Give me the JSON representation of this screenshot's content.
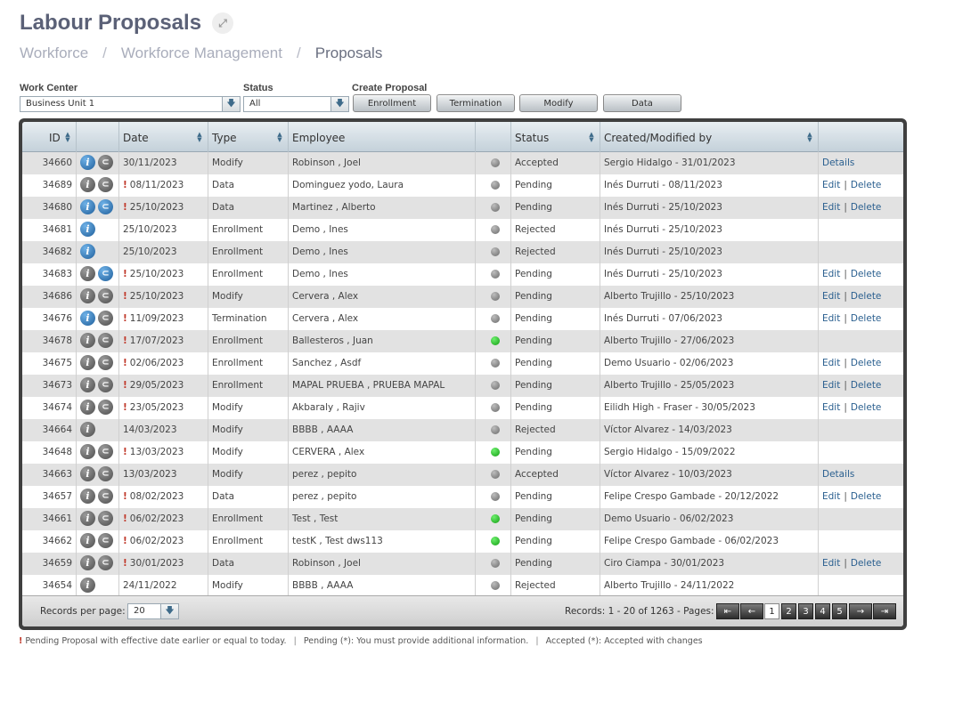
{
  "page": {
    "title": "Labour Proposals"
  },
  "breadcrumb": [
    "Workforce",
    "Workforce Management",
    "Proposals"
  ],
  "filters": {
    "work_center_label": "Work Center",
    "work_center_value": "Business Unit 1",
    "status_label": "Status",
    "status_value": "All",
    "create_label": "Create Proposal",
    "create_buttons": [
      "Enrollment",
      "Termination",
      "Modify",
      "Data"
    ]
  },
  "table": {
    "columns": [
      "ID",
      "Date",
      "Type",
      "Employee",
      "Status",
      "Created/Modified by"
    ],
    "rows": [
      {
        "id": "34660",
        "info": "blue",
        "clip": "grey",
        "warn": false,
        "date": "30/11/2023",
        "type": "Modify",
        "employee": "Robinson , Joel",
        "dot": "grey",
        "status": "Accepted",
        "by": "Sergio Hidalgo - 31/01/2023",
        "actions": [
          "Details"
        ]
      },
      {
        "id": "34689",
        "info": "grey",
        "clip": "grey",
        "warn": true,
        "date": "08/11/2023",
        "type": "Data",
        "employee": "Dominguez yodo, Laura",
        "dot": "grey",
        "status": "Pending",
        "by": "Inés Durruti - 08/11/2023",
        "actions": [
          "Edit",
          "Delete"
        ]
      },
      {
        "id": "34680",
        "info": "blue",
        "clip": "blue",
        "warn": true,
        "date": "25/10/2023",
        "type": "Data",
        "employee": "Martinez , Alberto",
        "dot": "grey",
        "status": "Pending",
        "by": "Inés Durruti - 25/10/2023",
        "actions": [
          "Edit",
          "Delete"
        ]
      },
      {
        "id": "34681",
        "info": "blue",
        "clip": "",
        "warn": false,
        "date": "25/10/2023",
        "type": "Enrollment",
        "employee": "Demo , Ines",
        "dot": "grey",
        "status": "Rejected",
        "by": "Inés Durruti - 25/10/2023",
        "actions": []
      },
      {
        "id": "34682",
        "info": "blue",
        "clip": "",
        "warn": false,
        "date": "25/10/2023",
        "type": "Enrollment",
        "employee": "Demo , Ines",
        "dot": "grey",
        "status": "Rejected",
        "by": "Inés Durruti - 25/10/2023",
        "actions": []
      },
      {
        "id": "34683",
        "info": "grey",
        "clip": "blue",
        "warn": true,
        "date": "25/10/2023",
        "type": "Enrollment",
        "employee": "Demo , Ines",
        "dot": "grey",
        "status": "Pending",
        "by": "Inés Durruti - 25/10/2023",
        "actions": [
          "Edit",
          "Delete"
        ]
      },
      {
        "id": "34686",
        "info": "grey",
        "clip": "grey",
        "warn": true,
        "date": "25/10/2023",
        "type": "Modify",
        "employee": "Cervera , Alex",
        "dot": "grey",
        "status": "Pending",
        "by": "Alberto Trujillo - 25/10/2023",
        "actions": [
          "Edit",
          "Delete"
        ]
      },
      {
        "id": "34676",
        "info": "blue",
        "clip": "grey",
        "warn": true,
        "date": "11/09/2023",
        "type": "Termination",
        "employee": "Cervera , Alex",
        "dot": "grey",
        "status": "Pending",
        "by": "Inés Durruti - 07/06/2023",
        "actions": [
          "Edit",
          "Delete"
        ]
      },
      {
        "id": "34678",
        "info": "grey",
        "clip": "grey",
        "warn": true,
        "date": "17/07/2023",
        "type": "Enrollment",
        "employee": "Ballesteros , Juan",
        "dot": "green",
        "status": "Pending",
        "by": "Alberto Trujillo - 27/06/2023",
        "actions": []
      },
      {
        "id": "34675",
        "info": "grey",
        "clip": "grey",
        "warn": true,
        "date": "02/06/2023",
        "type": "Enrollment",
        "employee": "Sanchez , Asdf",
        "dot": "grey",
        "status": "Pending",
        "by": "Demo Usuario - 02/06/2023",
        "actions": [
          "Edit",
          "Delete"
        ]
      },
      {
        "id": "34673",
        "info": "grey",
        "clip": "grey",
        "warn": true,
        "date": "29/05/2023",
        "type": "Enrollment",
        "employee": "MAPAL PRUEBA , PRUEBA MAPAL",
        "dot": "grey",
        "status": "Pending",
        "by": "Alberto Trujillo - 25/05/2023",
        "actions": [
          "Edit",
          "Delete"
        ]
      },
      {
        "id": "34674",
        "info": "grey",
        "clip": "grey",
        "warn": true,
        "date": "23/05/2023",
        "type": "Modify",
        "employee": "Akbaraly , Rajiv",
        "dot": "grey",
        "status": "Pending",
        "by": "Eilidh High - Fraser - 30/05/2023",
        "actions": [
          "Edit",
          "Delete"
        ]
      },
      {
        "id": "34664",
        "info": "grey",
        "clip": "",
        "warn": false,
        "date": "14/03/2023",
        "type": "Modify",
        "employee": "BBBB , AAAA",
        "dot": "grey",
        "status": "Rejected",
        "by": "Víctor Alvarez - 14/03/2023",
        "actions": []
      },
      {
        "id": "34648",
        "info": "grey",
        "clip": "grey",
        "warn": true,
        "date": "13/03/2023",
        "type": "Modify",
        "employee": "CERVERA , Alex",
        "dot": "green",
        "status": "Pending",
        "by": "Sergio Hidalgo - 15/09/2022",
        "actions": []
      },
      {
        "id": "34663",
        "info": "grey",
        "clip": "grey",
        "warn": false,
        "date": "13/03/2023",
        "type": "Modify",
        "employee": "perez , pepito",
        "dot": "grey",
        "status": "Accepted",
        "by": "Víctor Alvarez - 10/03/2023",
        "actions": [
          "Details"
        ]
      },
      {
        "id": "34657",
        "info": "grey",
        "clip": "grey",
        "warn": true,
        "date": "08/02/2023",
        "type": "Data",
        "employee": "perez , pepito",
        "dot": "grey",
        "status": "Pending",
        "by": "Felipe Crespo Gambade - 20/12/2022",
        "actions": [
          "Edit",
          "Delete"
        ]
      },
      {
        "id": "34661",
        "info": "grey",
        "clip": "grey",
        "warn": true,
        "date": "06/02/2023",
        "type": "Enrollment",
        "employee": "Test , Test",
        "dot": "green",
        "status": "Pending",
        "by": "Demo Usuario - 06/02/2023",
        "actions": []
      },
      {
        "id": "34662",
        "info": "grey",
        "clip": "grey",
        "warn": true,
        "date": "06/02/2023",
        "type": "Enrollment",
        "employee": "testK , Test dws113",
        "dot": "green",
        "status": "Pending",
        "by": "Felipe Crespo Gambade - 06/02/2023",
        "actions": []
      },
      {
        "id": "34659",
        "info": "grey",
        "clip": "grey",
        "warn": true,
        "date": "30/01/2023",
        "type": "Data",
        "employee": "Robinson , Joel",
        "dot": "grey",
        "status": "Pending",
        "by": "Ciro Ciampa - 30/01/2023",
        "actions": [
          "Edit",
          "Delete"
        ]
      },
      {
        "id": "34654",
        "info": "grey",
        "clip": "",
        "warn": false,
        "date": "24/11/2022",
        "type": "Modify",
        "employee": "BBBB , AAAA",
        "dot": "grey",
        "status": "Rejected",
        "by": "Alberto Trujillo - 24/11/2022",
        "actions": []
      }
    ]
  },
  "footer": {
    "records_per_page_label": "Records per page:",
    "records_per_page_value": "20",
    "records_info": "Records: 1 - 20 of 1263 - Pages:",
    "pages": [
      "1",
      "2",
      "3",
      "4",
      "5"
    ],
    "current_page": "1"
  },
  "legend": [
    {
      "marker": "!",
      "text": "Pending Proposal with effective date earlier or equal to today."
    },
    {
      "marker": "",
      "text": "Pending (*): You must provide additional information."
    },
    {
      "marker": "",
      "text": "Accepted (*): Accepted with changes"
    }
  ],
  "colors": {
    "warn": "#c0392b",
    "link": "#2a5f8f",
    "status_green": "#129d12",
    "info_blue": "#1f5e9a"
  },
  "icons": {
    "expand": "expand-icon",
    "info": "info-icon",
    "attachment": "paperclip-icon",
    "status": "status-dot-icon",
    "sort": "sort-icon"
  }
}
